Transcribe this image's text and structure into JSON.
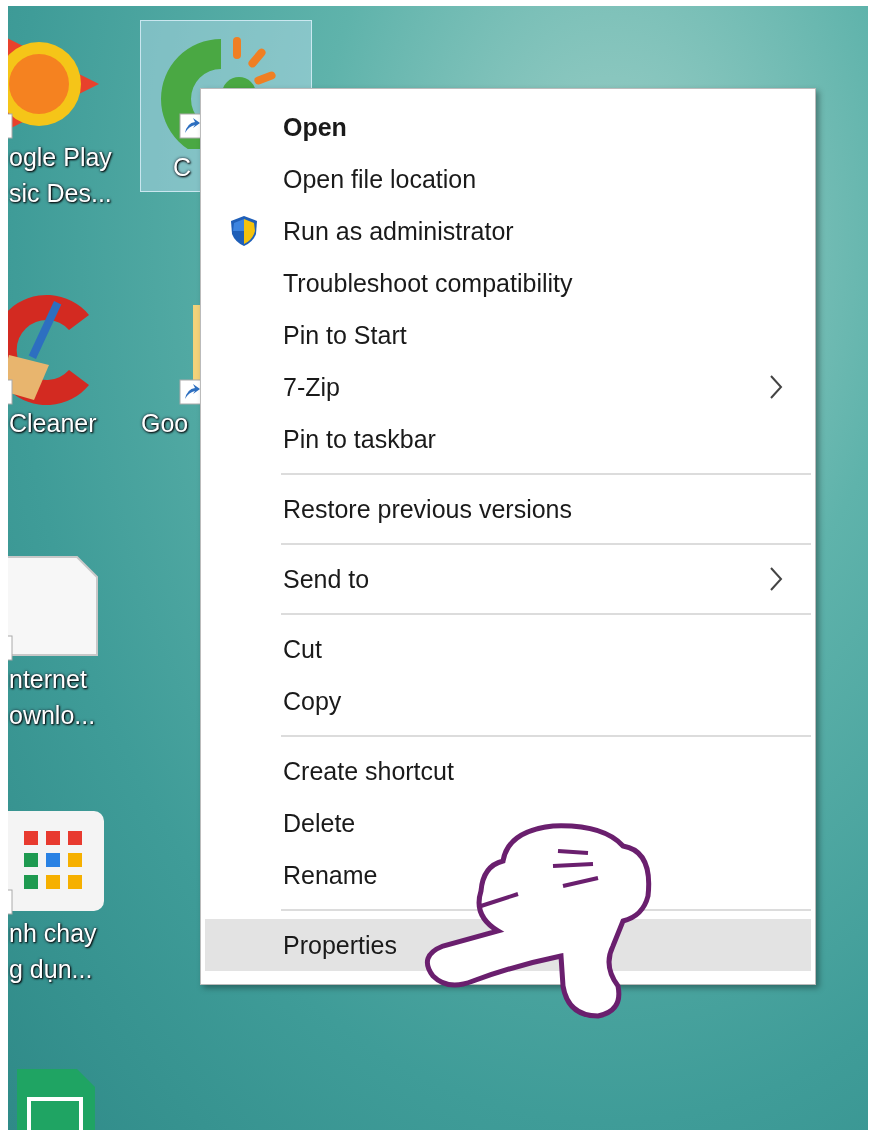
{
  "desktop_icons": [
    {
      "kind": "music",
      "lines": [
        "ogle Play",
        "sic Des..."
      ],
      "shortcut": true,
      "selected": false
    },
    {
      "kind": "browser",
      "lines": [
        "C"
      ],
      "shortcut": true,
      "selected": true
    },
    {
      "kind": "cleaner",
      "lines": [
        "Cleaner"
      ],
      "shortcut": true,
      "selected": false
    },
    {
      "kind": "folder",
      "lines": [
        "Goo"
      ],
      "shortcut": true,
      "selected": false
    },
    {
      "kind": "document",
      "lines": [
        "nternet",
        "ownlo..."
      ],
      "shortcut": true,
      "selected": false
    },
    {
      "kind": "launcher",
      "lines": [
        "nh chay",
        "g dụn..."
      ],
      "shortcut": true,
      "selected": false
    },
    {
      "kind": "spreadsheet",
      "shortcut": false,
      "selected": false
    }
  ],
  "context_menu": {
    "groups": [
      [
        {
          "label": "Open",
          "kind": "command",
          "default": true,
          "selected": false
        },
        {
          "label": "Open file location",
          "kind": "command",
          "default": false,
          "selected": false
        },
        {
          "label": "Run as administrator",
          "kind": "elevated",
          "default": false,
          "selected": false
        },
        {
          "label": "Troubleshoot compatibility",
          "kind": "command",
          "default": false,
          "selected": false
        },
        {
          "label": "Pin to Start",
          "kind": "command",
          "default": false,
          "selected": false
        },
        {
          "label": "7-Zip",
          "kind": "submenu",
          "default": false,
          "selected": false
        },
        {
          "label": "Pin to taskbar",
          "kind": "command",
          "default": false,
          "selected": false
        }
      ],
      [
        {
          "label": "Restore previous versions",
          "kind": "command",
          "default": false,
          "selected": false
        }
      ],
      [
        {
          "label": "Send to",
          "kind": "submenu",
          "default": false,
          "selected": false
        }
      ],
      [
        {
          "label": "Cut",
          "kind": "command",
          "default": false,
          "selected": false
        },
        {
          "label": "Copy",
          "kind": "command",
          "default": false,
          "selected": false
        }
      ],
      [
        {
          "label": "Create shortcut",
          "kind": "command",
          "default": false,
          "selected": false
        },
        {
          "label": "Delete",
          "kind": "command",
          "default": false,
          "selected": false
        },
        {
          "label": "Rename",
          "kind": "command",
          "default": false,
          "selected": false
        }
      ],
      [
        {
          "label": "Properties",
          "kind": "command",
          "default": false,
          "selected": true
        }
      ]
    ]
  }
}
